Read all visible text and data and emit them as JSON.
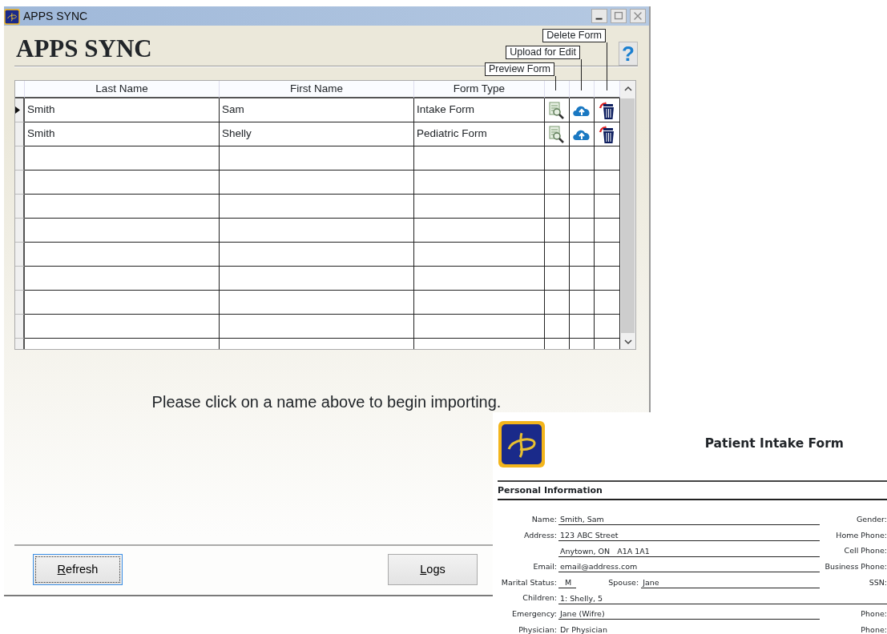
{
  "window": {
    "title": "APPS SYNC"
  },
  "header": {
    "title": "APPS SYNC",
    "help": "?"
  },
  "column_hints": [
    {
      "label": "Delete Form"
    },
    {
      "label": "Upload for Edit"
    },
    {
      "label": "Preview Form"
    }
  ],
  "table": {
    "columns": [
      "Last Name",
      "First Name",
      "Form Type"
    ],
    "rows": [
      {
        "cells": [
          "Smith",
          "Sam",
          "Intake Form"
        ],
        "selected": true
      },
      {
        "cells": [
          "Smith",
          "Shelly",
          "Pediatric Form"
        ],
        "selected": false
      }
    ]
  },
  "message": "Please click on a name above to begin importing.",
  "buttons": [
    {
      "label": "Refresh",
      "focused": true
    },
    {
      "label": "Logs",
      "focused": false
    }
  ],
  "document": {
    "title": "Patient Intake Form",
    "section": "Personal Information",
    "fields": [
      {
        "kind": "line",
        "label": "Name:",
        "value": "Smith, Sam",
        "right_label": "Gender:"
      },
      {
        "kind": "line",
        "label": "Address:",
        "value": "123 ABC Street",
        "right_label": "Home Phone:"
      },
      {
        "kind": "line",
        "value": "Anytown, ON   A1A 1A1",
        "right_label": "Cell Phone:"
      },
      {
        "kind": "line",
        "label": "Email:",
        "value": "email@address.com",
        "right_label": "Business Phone:"
      },
      {
        "kind": "pair",
        "label": "Marital Status:",
        "value": "M",
        "label2": "Spouse:",
        "value2": "Jane",
        "right_label": "SSN:"
      },
      {
        "kind": "wide",
        "label": "Children:",
        "value": "1: Shelly, 5"
      },
      {
        "kind": "line",
        "label": "Emergency:",
        "value": "Jane (Wifre)",
        "right_label": "Phone:"
      },
      {
        "kind": "line",
        "label": "Physician:",
        "value": "Dr Physician",
        "right_label": "Phone:"
      }
    ]
  }
}
